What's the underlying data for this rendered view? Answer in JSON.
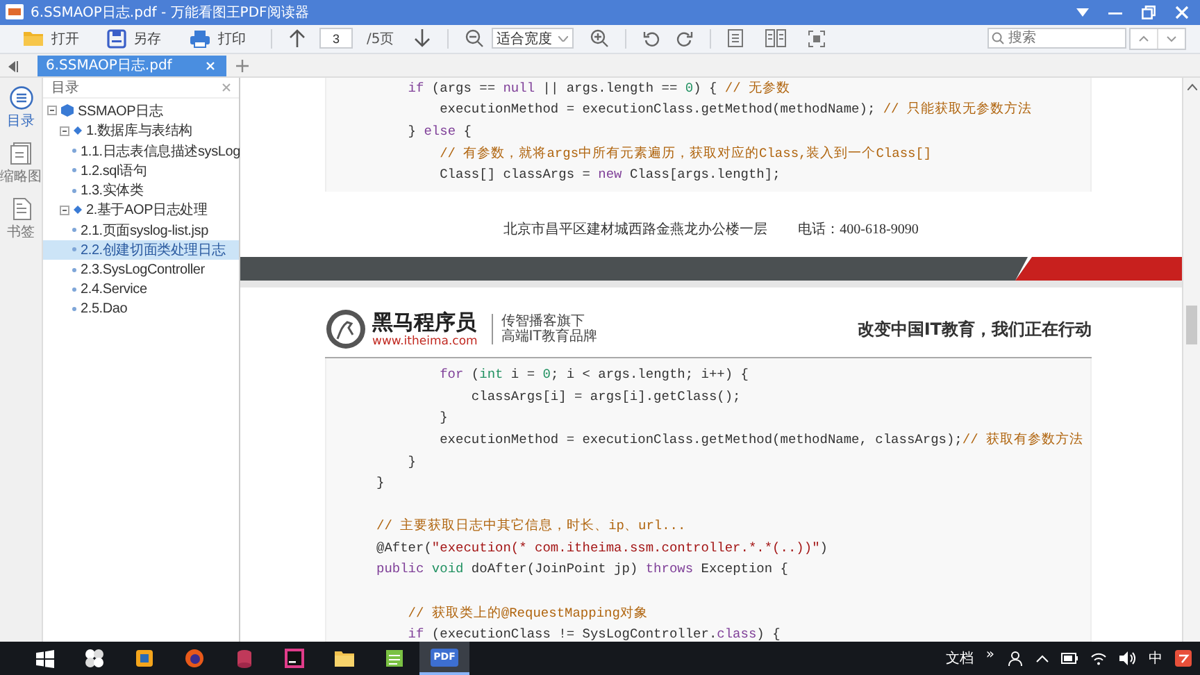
{
  "window": {
    "title": "6.SSMAOP日志.pdf - 万能看图王PDF阅读器"
  },
  "toolbar": {
    "buttons": [
      {
        "kind": "open",
        "label": "打开"
      },
      {
        "kind": "save",
        "label": "另存"
      },
      {
        "kind": "print",
        "label": "打印"
      }
    ],
    "page_field": {
      "value": "3"
    },
    "page_total": "/5页",
    "zoom_select": {
      "value": "适合宽度"
    },
    "search": {
      "placeholder": "搜索"
    }
  },
  "tabs": [
    {
      "label": "6.SSMAOP日志.pdf",
      "selected": true
    }
  ],
  "side_strip": [
    {
      "kind": "toc",
      "label": "目录",
      "selected": true
    },
    {
      "kind": "thumbs",
      "label": "缩略图",
      "selected": false
    },
    {
      "kind": "bookmarks",
      "label": "书签",
      "selected": false
    }
  ],
  "toc": {
    "title": "目录",
    "items": [
      {
        "label": "SSMAOP日志",
        "expanded": true,
        "selected": false,
        "children": [
          {
            "label": "1.数据库与表结构",
            "expanded": true,
            "selected": false,
            "children": [
              {
                "label": "1.1.日志表信息描述sysLog",
                "selected": false
              },
              {
                "label": "1.2.sql语句",
                "selected": false
              },
              {
                "label": "1.3.实体类",
                "selected": false
              }
            ]
          },
          {
            "label": "2.基于AOP日志处理",
            "expanded": true,
            "selected": false,
            "children": [
              {
                "label": "2.1.页面syslog-list.jsp",
                "selected": false
              },
              {
                "label": "2.2.创建切面类处理日志",
                "selected": true
              },
              {
                "label": "2.3.SysLogController",
                "selected": false
              },
              {
                "label": "2.4.Service",
                "selected": false
              },
              {
                "label": "2.5.Dao",
                "selected": false
              }
            ]
          }
        ]
      }
    ]
  },
  "document": {
    "pages": [
      {
        "code_lines": [
          {
            "kind": "code",
            "segments": [
              {
                "kind": "keyword",
                "text": "    if"
              },
              {
                "kind": "plain",
                "text": " (args == "
              },
              {
                "kind": "keyword",
                "text": "null"
              },
              {
                "kind": "plain",
                "text": " || args.length == "
              },
              {
                "kind": "number",
                "text": "0"
              },
              {
                "kind": "plain",
                "text": ") { "
              },
              {
                "kind": "comment",
                "text": "// 无参数"
              }
            ]
          },
          {
            "kind": "code",
            "segments": [
              {
                "kind": "plain",
                "text": "        executionMethod = executionClass.getMethod(methodName); "
              },
              {
                "kind": "comment",
                "text": "// 只能获取无参数方法"
              }
            ]
          },
          {
            "kind": "code",
            "segments": [
              {
                "kind": "plain",
                "text": "    } "
              },
              {
                "kind": "keyword",
                "text": "else"
              },
              {
                "kind": "plain",
                "text": " {"
              }
            ]
          },
          {
            "kind": "code",
            "segments": [
              {
                "kind": "comment",
                "text": "        // 有参数，就将args中所有元素遍历，获取对应的Class,装入到一个Class[]"
              }
            ]
          },
          {
            "kind": "code",
            "segments": [
              {
                "kind": "plain",
                "text": "        Class[] classArgs = "
              },
              {
                "kind": "keyword",
                "text": "new"
              },
              {
                "kind": "plain",
                "text": " Class[args.length];"
              }
            ]
          }
        ],
        "footer": {
          "address": "北京市昌平区建材城西路金燕龙办公楼一层",
          "phone": "电话：400-618-9090"
        }
      },
      {
        "header": {
          "brand": "黑马程序员",
          "url": "www.itheima.com",
          "tagline_1": "传智播客旗下",
          "tagline_2": "高端IT教育品牌",
          "slogan": "改变中国IT教育，我们正在行动"
        },
        "code_lines": [
          {
            "kind": "code",
            "segments": [
              {
                "kind": "keyword",
                "text": "        for"
              },
              {
                "kind": "plain",
                "text": " ("
              },
              {
                "kind": "type",
                "text": "int"
              },
              {
                "kind": "plain",
                "text": " i = "
              },
              {
                "kind": "number",
                "text": "0"
              },
              {
                "kind": "plain",
                "text": "; i < args.length; i++) {"
              }
            ]
          },
          {
            "kind": "code",
            "segments": [
              {
                "kind": "plain",
                "text": "            classArgs[i] = args[i].getClass();"
              }
            ]
          },
          {
            "kind": "code",
            "segments": [
              {
                "kind": "plain",
                "text": "        }"
              }
            ]
          },
          {
            "kind": "code",
            "segments": [
              {
                "kind": "plain",
                "text": "        executionMethod = executionClass.getMethod(methodName, classArgs);"
              },
              {
                "kind": "comment",
                "text": "// 获取有参数方法"
              }
            ]
          },
          {
            "kind": "code",
            "segments": [
              {
                "kind": "plain",
                "text": "    }"
              }
            ]
          },
          {
            "kind": "code",
            "segments": [
              {
                "kind": "plain",
                "text": "}"
              }
            ]
          },
          {
            "kind": "blank"
          },
          {
            "kind": "code",
            "segments": [
              {
                "kind": "comment",
                "text": "// 主要获取日志中其它信息，时长、ip、url..."
              }
            ]
          },
          {
            "kind": "code",
            "segments": [
              {
                "kind": "plain",
                "text": "@After("
              },
              {
                "kind": "string",
                "text": "\"execution(* com.itheima.ssm.controller.*.*(..))\""
              },
              {
                "kind": "plain",
                "text": ")"
              }
            ]
          },
          {
            "kind": "code",
            "segments": [
              {
                "kind": "keyword",
                "text": "public"
              },
              {
                "kind": "type",
                "text": " void"
              },
              {
                "kind": "plain",
                "text": " doAfter(JoinPoint jp) "
              },
              {
                "kind": "keyword",
                "text": "throws"
              },
              {
                "kind": "plain",
                "text": " Exception {"
              }
            ]
          },
          {
            "kind": "blank"
          },
          {
            "kind": "code",
            "segments": [
              {
                "kind": "comment",
                "text": "    // 获取类上的@RequestMapping对象"
              }
            ]
          },
          {
            "kind": "code",
            "segments": [
              {
                "kind": "keyword",
                "text": "    if"
              },
              {
                "kind": "plain",
                "text": " (executionClass != SysLogController."
              },
              {
                "kind": "keyword",
                "text": "class"
              },
              {
                "kind": "plain",
                "text": ") {"
              }
            ]
          }
        ]
      }
    ]
  },
  "taskbar": {
    "apps": [
      {
        "kind": "start",
        "selected": false
      },
      {
        "kind": "pinwheel",
        "selected": false
      },
      {
        "kind": "vm",
        "selected": false
      },
      {
        "kind": "firefox",
        "selected": false
      },
      {
        "kind": "database",
        "selected": false
      },
      {
        "kind": "ide",
        "selected": false
      },
      {
        "kind": "folder",
        "selected": false
      },
      {
        "kind": "notepad",
        "selected": false
      },
      {
        "kind": "pdf",
        "label": "PDF",
        "selected": true
      }
    ],
    "tray": {
      "label": "文档",
      "more": "»",
      "ime": "中"
    }
  }
}
